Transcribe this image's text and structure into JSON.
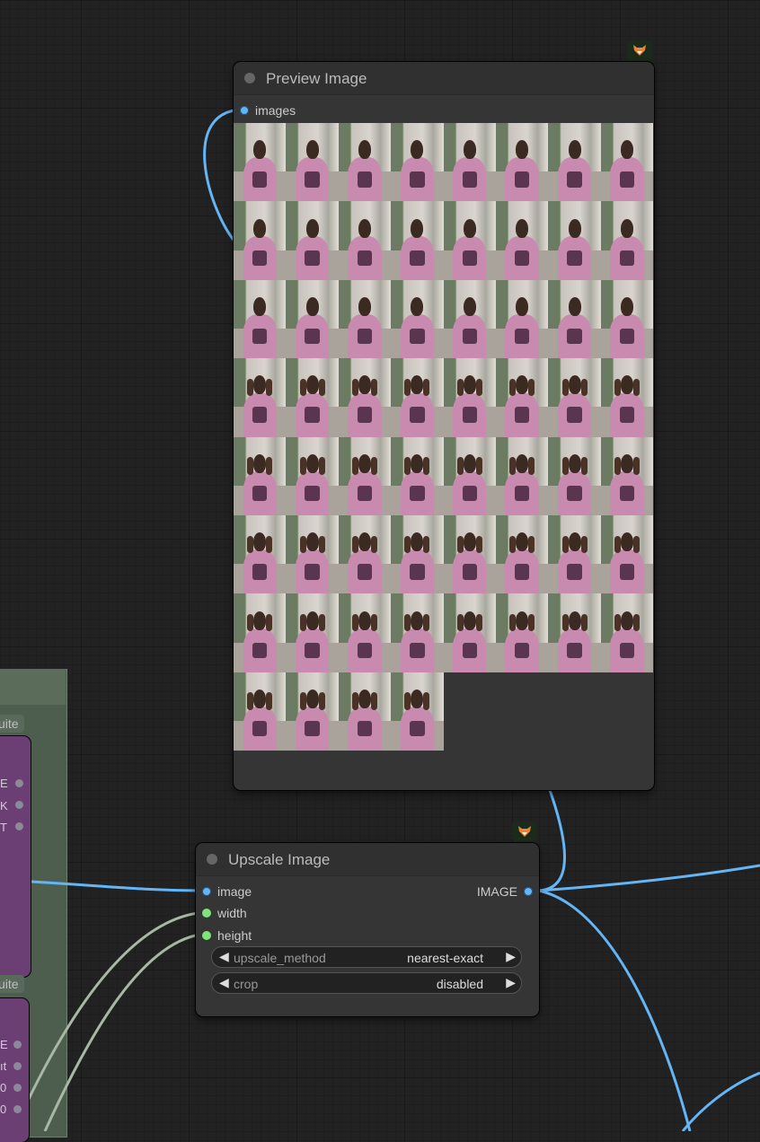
{
  "preview_node": {
    "title": "Preview Image",
    "input_label": "images",
    "image_count": 60,
    "columns": 8
  },
  "upscale_node": {
    "title": "Upscale Image",
    "inputs": [
      "image",
      "width",
      "height"
    ],
    "output_label": "IMAGE",
    "widgets": [
      {
        "label": "upscale_method",
        "value": "nearest-exact"
      },
      {
        "label": "crop",
        "value": "disabled"
      }
    ]
  },
  "left_group": {
    "tag1": "uite",
    "tag2": "uite",
    "slots_a": [
      "E",
      "K",
      "T"
    ],
    "slots_b": [
      "E",
      "ıt",
      "0",
      "0"
    ]
  },
  "colors": {
    "image_wire": "#64b5f6",
    "int_wire": "#a8b8a4",
    "image_pin": "#64b5f6",
    "int_pin": "#7de47a"
  },
  "icons": {
    "badge": "fox-icon"
  }
}
